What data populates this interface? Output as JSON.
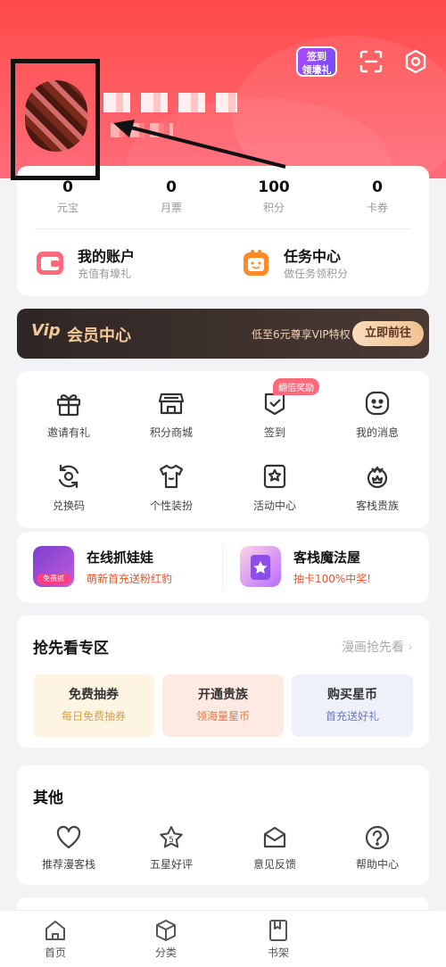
{
  "header": {
    "signin_badge": "签到\n领壕礼",
    "colors": {
      "hero": "#ff4f55",
      "accent": "#ff6b7a"
    }
  },
  "stats": [
    {
      "value": "0",
      "label": "元宝"
    },
    {
      "value": "0",
      "label": "月票"
    },
    {
      "value": "100",
      "label": "积分"
    },
    {
      "value": "0",
      "label": "卡券"
    }
  ],
  "features": [
    {
      "title": "我的账户",
      "subtitle": "充值有壕礼",
      "icon": "wallet-icon"
    },
    {
      "title": "任务中心",
      "subtitle": "做任务领积分",
      "icon": "task-icon"
    }
  ],
  "vip": {
    "logo": "Vip",
    "title": "会员中心",
    "desc": "低至6元尊享VIP特权",
    "button": "立即前往"
  },
  "grid": {
    "badge": "翻倍奖励",
    "items": [
      {
        "label": "邀请有礼",
        "icon": "gift-icon"
      },
      {
        "label": "积分商城",
        "icon": "store-icon"
      },
      {
        "label": "签到",
        "icon": "checkin-icon"
      },
      {
        "label": "我的消息",
        "icon": "message-icon"
      },
      {
        "label": "兑换码",
        "icon": "redeem-icon"
      },
      {
        "label": "个性装扮",
        "icon": "shirt-icon"
      },
      {
        "label": "活动中心",
        "icon": "activity-icon"
      },
      {
        "label": "客栈贵族",
        "icon": "crown-icon"
      }
    ]
  },
  "promos": [
    {
      "title": "在线抓娃娃",
      "subtitle": "萌新首充送粉红豹",
      "tag": "免费抓"
    },
    {
      "title": "客栈魔法屋",
      "subtitle": "抽卡100%中奖!"
    }
  ],
  "preview": {
    "title": "抢先看专区",
    "more": "漫画抢先看",
    "tiles": [
      {
        "title": "免费抽券",
        "subtitle": "每日免费抽券",
        "color": "#d9a24a"
      },
      {
        "title": "开通贵族",
        "subtitle": "领海量星币",
        "color": "#e07a4a"
      },
      {
        "title": "购买星币",
        "subtitle": "首充送好礼",
        "color": "#6a78c8"
      }
    ]
  },
  "other": {
    "title": "其他",
    "items": [
      {
        "label": "推荐漫客栈",
        "icon": "heart-icon"
      },
      {
        "label": "五星好评",
        "icon": "star-icon"
      },
      {
        "label": "意见反馈",
        "icon": "feedback-icon"
      },
      {
        "label": "帮助中心",
        "icon": "help-icon"
      }
    ]
  },
  "tabbar": [
    {
      "label": "首页",
      "icon": "home-icon"
    },
    {
      "label": "分类",
      "icon": "category-icon"
    },
    {
      "label": "书架",
      "icon": "bookshelf-icon"
    }
  ]
}
